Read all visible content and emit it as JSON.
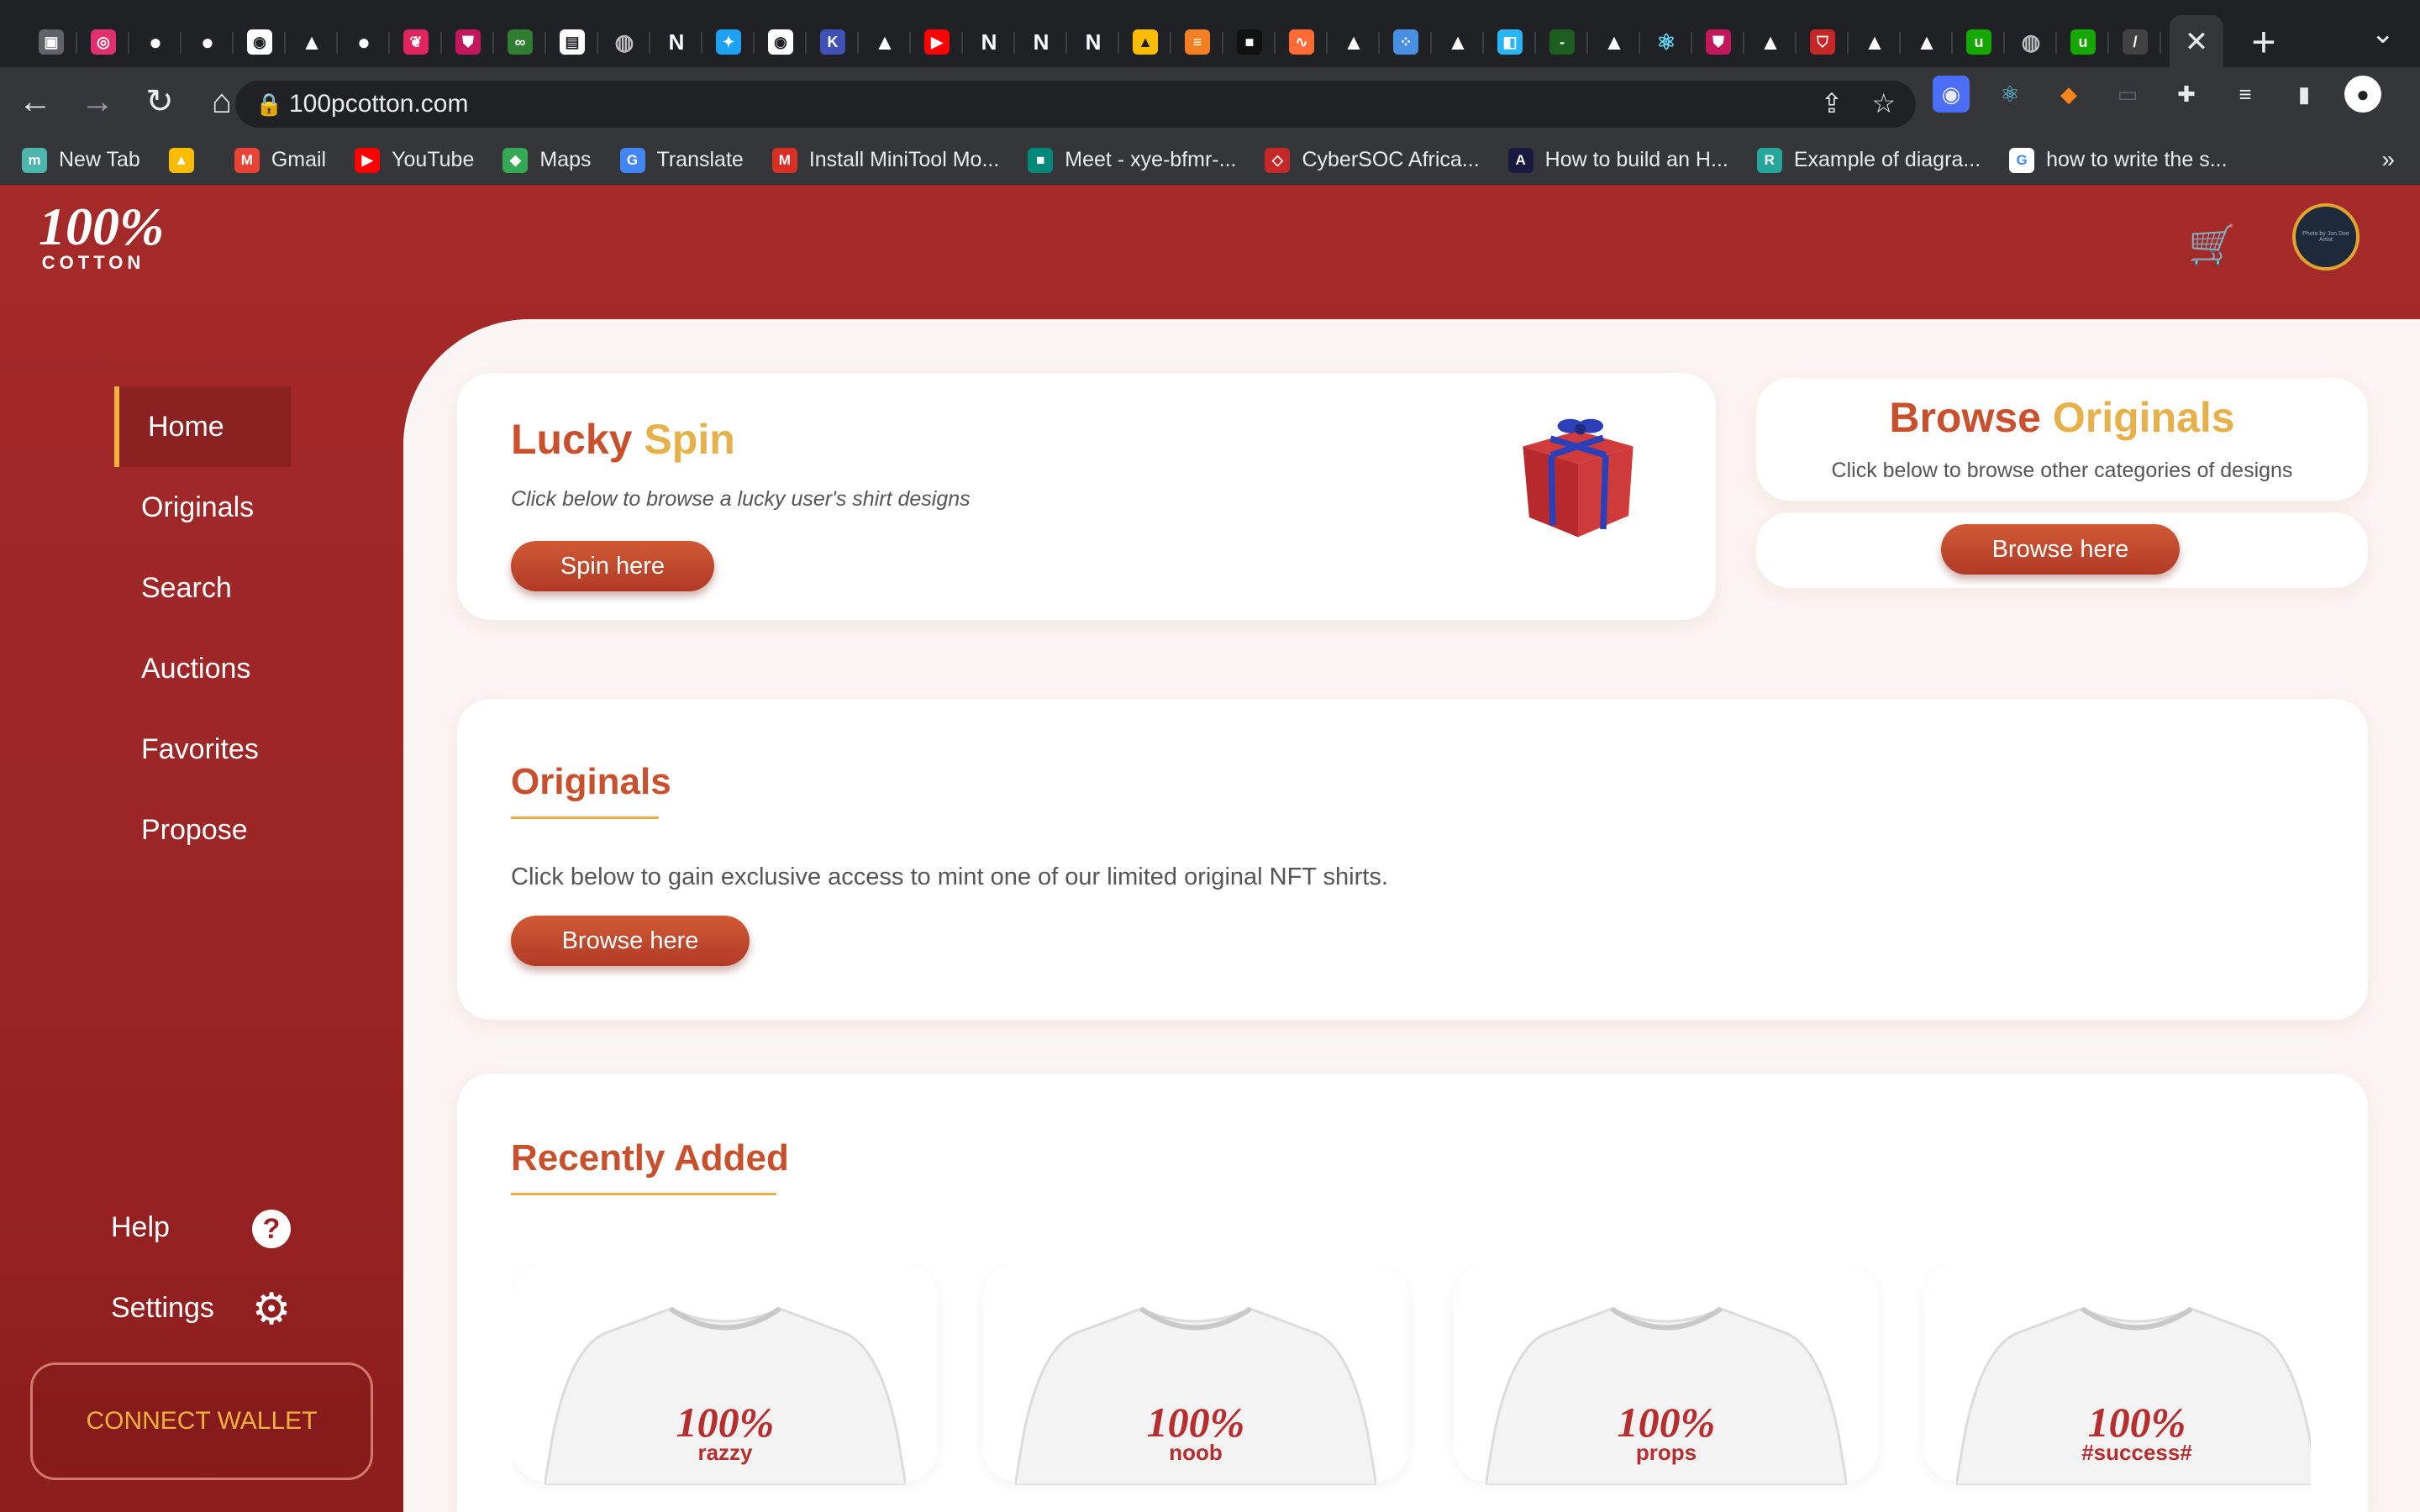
{
  "browser": {
    "tab_icons": [
      "screenshot-tab-icon",
      "instagram-tab-icon",
      "github-tab-icon",
      "github-tab-icon",
      "circle-tab-icon",
      "triangle-tab-icon",
      "github-tab-icon",
      "bird-tab-icon",
      "shield-tab-icon",
      "infinity-tab-icon",
      "doc-tab-icon",
      "globe-tab-icon",
      "notion-tab-icon",
      "twitter-tab-icon",
      "circle-tab-icon",
      "k-tab-icon",
      "triangle-tab-icon",
      "youtube-tab-icon",
      "notion-tab-icon",
      "notion-tab-icon",
      "notion-tab-icon",
      "drive-tab-icon",
      "stackoverflow-tab-icon",
      "dark-tab-icon",
      "chart-tab-icon",
      "triangle-tab-icon",
      "bubbles-tab-icon",
      "triangle-tab-icon",
      "square-tab-icon",
      "dash-tab-icon",
      "triangle-tab-icon",
      "react-tab-icon",
      "shield-tab-icon",
      "triangle-tab-icon",
      "shield-outline-tab-icon",
      "triangle-tab-icon",
      "triangle-tab-icon",
      "upwork-tab-icon",
      "globe-tab-icon",
      "upwork-tab-icon",
      "slash-tab-icon"
    ],
    "active_tab_close": "✕",
    "new_tab": "+",
    "url": "100pcotton.com",
    "bookmarks": [
      {
        "label": "New Tab",
        "color": "#4db6ac",
        "glyph": "m"
      },
      {
        "label": "",
        "color": "#fbbc04",
        "glyph": "▲"
      },
      {
        "label": "Gmail",
        "color": "#ea4335",
        "glyph": "M"
      },
      {
        "label": "YouTube",
        "color": "#ff0000",
        "glyph": "▶"
      },
      {
        "label": "Maps",
        "color": "#34a853",
        "glyph": "◆"
      },
      {
        "label": "Translate",
        "color": "#4285f4",
        "glyph": "G"
      },
      {
        "label": "Install MiniTool Mo...",
        "color": "#d93025",
        "glyph": "M"
      },
      {
        "label": "Meet - xye-bfmr-...",
        "color": "#00897b",
        "glyph": "■"
      },
      {
        "label": "CyberSOC Africa...",
        "color": "#c62828",
        "glyph": "◇"
      },
      {
        "label": "How to build an H...",
        "color": "#1a1a40",
        "glyph": "A"
      },
      {
        "label": "Example of diagra...",
        "color": "#26a69a",
        "glyph": "R"
      },
      {
        "label": "how to write the s...",
        "color": "#ffffff",
        "glyph": "G"
      }
    ],
    "bookmarks_more": "»"
  },
  "site": {
    "logo_number": "100%",
    "logo_word": "COTTON",
    "avatar_text": "Photo by Jon Doe Artist",
    "nav": [
      "Home",
      "Originals",
      "Search",
      "Auctions",
      "Favorites",
      "Propose"
    ],
    "help_label": "Help",
    "settings_label": "Settings",
    "wallet_button": "CONNECT WALLET"
  },
  "lucky_spin": {
    "title_a": "Lucky",
    "title_b": "Spin",
    "subtitle": "Click below to browse a lucky user's shirt designs",
    "button": "Spin here"
  },
  "browse_originals": {
    "title_a": "Browse",
    "title_b": "Originals",
    "subtitle": "Click below to browse other categories of designs",
    "button": "Browse here"
  },
  "originals": {
    "title": "Originals",
    "subtitle": "Click below to gain exclusive access to mint one of our limited original NFT shirts.",
    "button": "Browse here"
  },
  "recently_added": {
    "title": "Recently Added",
    "shirts": [
      {
        "brand": "100%",
        "tag": "razzy"
      },
      {
        "brand": "100%",
        "tag": "noob"
      },
      {
        "brand": "100%",
        "tag": "props"
      },
      {
        "brand": "100%",
        "tag": "#success#"
      }
    ]
  }
}
